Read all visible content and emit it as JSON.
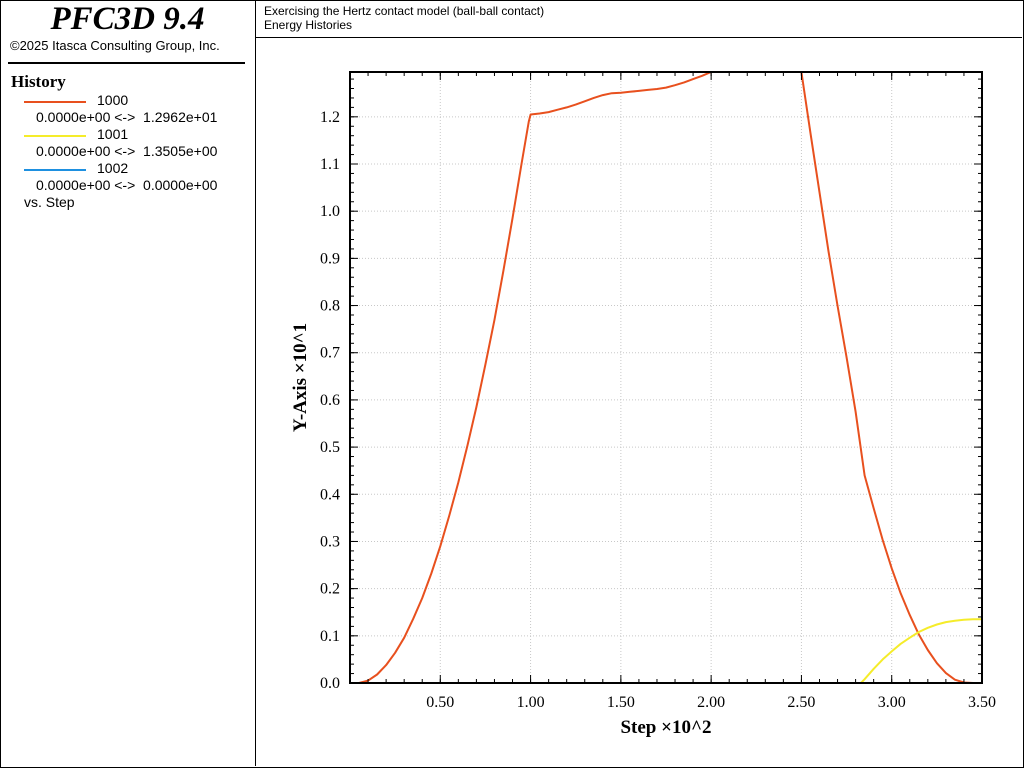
{
  "app": {
    "title": "PFC3D 9.4",
    "copyright": "©2025 Itasca Consulting Group, Inc."
  },
  "header": {
    "line1": "Exercising the Hertz contact model (ball-ball contact)",
    "line2": "Energy Histories"
  },
  "legend": {
    "heading": "History",
    "items": [
      {
        "name": "1000",
        "range": "0.0000e+00 <->  1.2962e+01",
        "color": "#e8501e"
      },
      {
        "name": "1001",
        "range": "0.0000e+00 <->  1.3505e+00",
        "color": "#f5ec2a"
      },
      {
        "name": "1002",
        "range": "0.0000e+00 <->  0.0000e+00",
        "color": "#1e90e0"
      }
    ],
    "vs_label": "vs. Step"
  },
  "chart_data": {
    "type": "line",
    "xlabel": "Step ×10^2",
    "ylabel": "Y-Axis ×10^1",
    "xlim": [
      0.0,
      3.5
    ],
    "ylim": [
      0.0,
      1.295
    ],
    "xticks": [
      "0.50",
      "1.00",
      "1.50",
      "2.00",
      "2.50",
      "3.00",
      "3.50"
    ],
    "yticks": [
      "0.0",
      "0.1",
      "0.2",
      "0.3",
      "0.4",
      "0.5",
      "0.6",
      "0.7",
      "0.8",
      "0.9",
      "1.0",
      "1.1",
      "1.2"
    ],
    "grid": true,
    "series": [
      {
        "name": "1000",
        "color": "#e8501e",
        "x": [
          0.05,
          0.1,
          0.15,
          0.2,
          0.25,
          0.3,
          0.35,
          0.4,
          0.45,
          0.5,
          0.55,
          0.6,
          0.65,
          0.7,
          0.75,
          0.8,
          0.85,
          0.9,
          0.95,
          0.99,
          1.0,
          1.05,
          1.1,
          1.15,
          1.2,
          1.25,
          1.3,
          1.35,
          1.4,
          1.45,
          1.5,
          1.55,
          1.6,
          1.65,
          1.7,
          1.75,
          1.8,
          1.85,
          1.9,
          1.95,
          2.0
        ],
        "y": [
          0.0,
          0.005,
          0.018,
          0.038,
          0.064,
          0.096,
          0.136,
          0.18,
          0.232,
          0.29,
          0.355,
          0.425,
          0.503,
          0.585,
          0.675,
          0.77,
          0.875,
          0.985,
          1.1,
          1.19,
          1.205,
          1.207,
          1.21,
          1.215,
          1.22,
          1.226,
          1.233,
          1.24,
          1.246,
          1.25,
          1.251,
          1.253,
          1.255,
          1.257,
          1.259,
          1.262,
          1.267,
          1.273,
          1.28,
          1.287,
          1.295
        ]
      },
      {
        "name": "1000",
        "color": "#e8501e",
        "x": [
          2.5,
          2.55,
          2.6,
          2.65,
          2.7,
          2.75,
          2.8,
          2.85,
          2.9,
          2.95,
          3.0,
          3.05,
          3.1,
          3.15,
          3.2,
          3.25,
          3.3,
          3.35,
          3.4,
          3.45
        ],
        "y": [
          1.295,
          1.165,
          1.04,
          0.915,
          0.8,
          0.69,
          0.575,
          0.44,
          0.37,
          0.303,
          0.243,
          0.19,
          0.144,
          0.103,
          0.07,
          0.042,
          0.021,
          0.007,
          0.001,
          0.0
        ]
      },
      {
        "name": "1001",
        "color": "#f5ec2a",
        "x": [
          2.83,
          2.85,
          2.9,
          2.95,
          3.0,
          3.05,
          3.1,
          3.15,
          3.2,
          3.25,
          3.3,
          3.35,
          3.4,
          3.45,
          3.5
        ],
        "y": [
          0.0,
          0.008,
          0.03,
          0.05,
          0.067,
          0.083,
          0.096,
          0.108,
          0.117,
          0.124,
          0.129,
          0.132,
          0.134,
          0.135,
          0.135
        ]
      },
      {
        "name": "1002",
        "color": "#1e90e0",
        "x": [
          0.0,
          3.5
        ],
        "y": [
          0.0,
          0.0
        ]
      }
    ]
  }
}
